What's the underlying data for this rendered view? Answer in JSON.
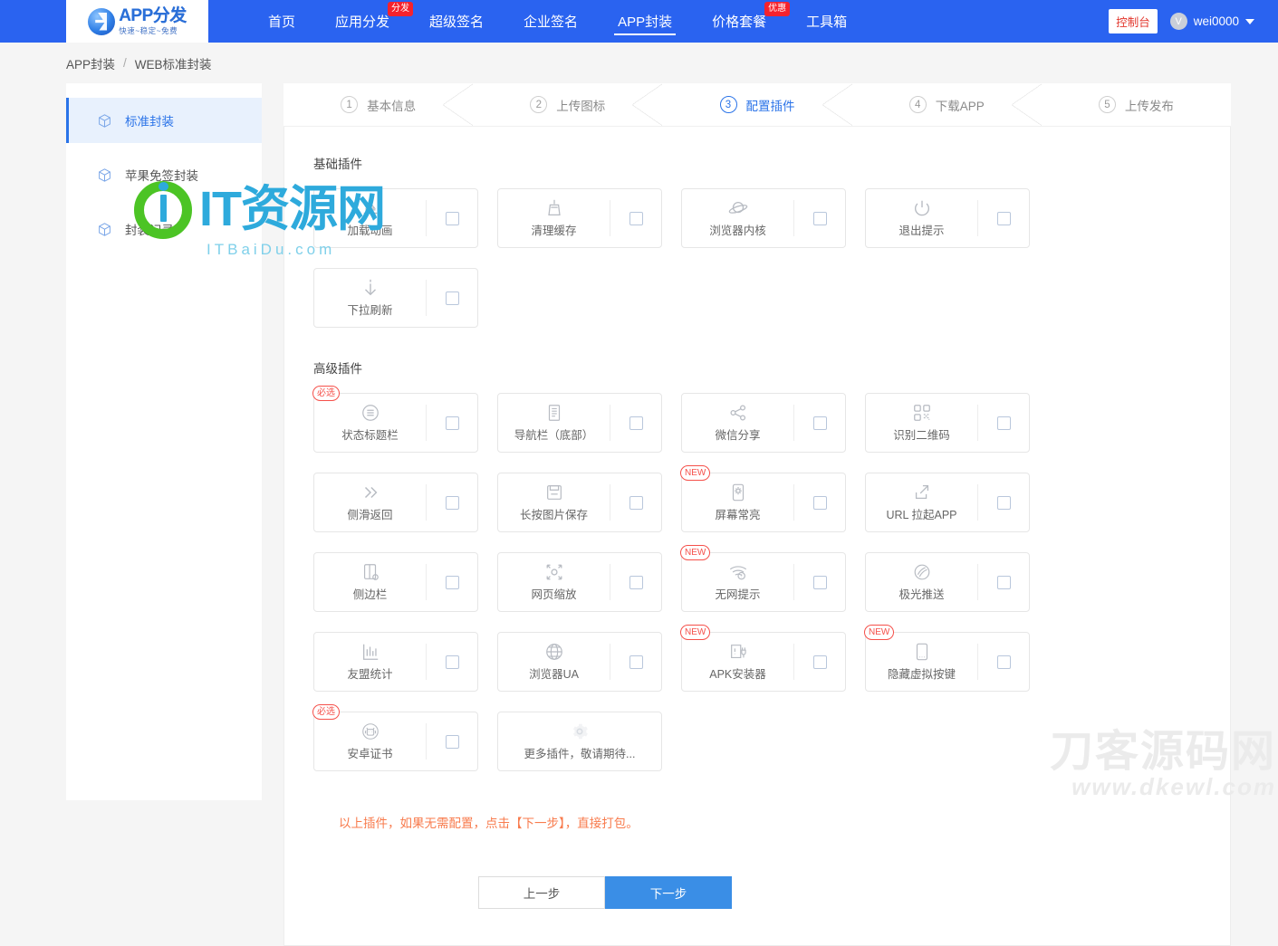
{
  "header": {
    "logo": {
      "title": "APP分发",
      "subtitle": "快速~稳定~免费"
    },
    "nav": [
      {
        "label": "首页",
        "badge": "",
        "active": false
      },
      {
        "label": "应用分发",
        "badge": "分发",
        "active": false
      },
      {
        "label": "超级签名",
        "badge": "",
        "active": false
      },
      {
        "label": "企业签名",
        "badge": "",
        "active": false
      },
      {
        "label": "APP封装",
        "badge": "",
        "active": true
      },
      {
        "label": "价格套餐",
        "badge": "优惠",
        "active": false
      },
      {
        "label": "工具箱",
        "badge": "",
        "active": false
      }
    ],
    "console_label": "控制台",
    "user_initial": "V",
    "user_name": "wei0000"
  },
  "breadcrumb": {
    "root": "APP封装",
    "separator": "/",
    "current": "WEB标准封装"
  },
  "sidebar": {
    "items": [
      {
        "label": "标准封装",
        "icon": "cube-icon",
        "active": true
      },
      {
        "label": "苹果免签封装",
        "icon": "cube-icon",
        "active": false
      },
      {
        "label": "封装记录",
        "icon": "cube-icon",
        "active": false
      }
    ]
  },
  "steps": [
    {
      "num": "1",
      "label": "基本信息",
      "active": false
    },
    {
      "num": "2",
      "label": "上传图标",
      "active": false
    },
    {
      "num": "3",
      "label": "配置插件",
      "active": true
    },
    {
      "num": "4",
      "label": "下载APP",
      "active": false
    },
    {
      "num": "5",
      "label": "上传发布",
      "active": false
    }
  ],
  "sections": {
    "basic_title": "基础插件",
    "advanced_title": "高级插件"
  },
  "basic_plugins": [
    {
      "label": "加载动画",
      "icon": "loading-animation-icon",
      "badge": "",
      "checkbox": true
    },
    {
      "label": "清理缓存",
      "icon": "broom-icon",
      "badge": "",
      "checkbox": true
    },
    {
      "label": "浏览器内核",
      "icon": "planet-icon",
      "badge": "",
      "checkbox": true
    },
    {
      "label": "退出提示",
      "icon": "power-icon",
      "badge": "",
      "checkbox": true
    },
    {
      "label": "下拉刷新",
      "icon": "arrow-down-icon",
      "badge": "",
      "checkbox": true
    }
  ],
  "advanced_plugins": [
    {
      "label": "状态标题栏",
      "icon": "menu-circle-icon",
      "badge": "必选",
      "checkbox": true
    },
    {
      "label": "导航栏（底部）",
      "icon": "document-lines-icon",
      "badge": "",
      "checkbox": true
    },
    {
      "label": "微信分享",
      "icon": "share-nodes-icon",
      "badge": "",
      "checkbox": true
    },
    {
      "label": "识别二维码",
      "icon": "qrcode-icon",
      "badge": "",
      "checkbox": true
    },
    {
      "label": "侧滑返回",
      "icon": "chevron-double-right-icon",
      "badge": "",
      "checkbox": true
    },
    {
      "label": "长按图片保存",
      "icon": "save-floppy-icon",
      "badge": "",
      "checkbox": true
    },
    {
      "label": "屏幕常亮",
      "icon": "phone-brightness-icon",
      "badge": "NEW",
      "checkbox": true
    },
    {
      "label": "URL 拉起APP",
      "icon": "external-launch-icon",
      "badge": "",
      "checkbox": true
    },
    {
      "label": "侧边栏",
      "icon": "sidebar-icon",
      "badge": "",
      "checkbox": true
    },
    {
      "label": "网页缩放",
      "icon": "expand-arrows-icon",
      "badge": "",
      "checkbox": true
    },
    {
      "label": "无网提示",
      "icon": "wifi-warning-icon",
      "badge": "NEW",
      "checkbox": true
    },
    {
      "label": "极光推送",
      "icon": "aurora-push-icon",
      "badge": "",
      "checkbox": true
    },
    {
      "label": "友盟统计",
      "icon": "bar-chart-icon",
      "badge": "",
      "checkbox": true
    },
    {
      "label": "浏览器UA",
      "icon": "globe-icon",
      "badge": "",
      "checkbox": true
    },
    {
      "label": "APK安装器",
      "icon": "apk-installer-icon",
      "badge": "NEW",
      "checkbox": true
    },
    {
      "label": "隐藏虚拟按键",
      "icon": "phone-keys-icon",
      "badge": "NEW",
      "checkbox": true
    },
    {
      "label": "安卓证书",
      "icon": "android-icon",
      "badge": "必选",
      "checkbox": true
    },
    {
      "label": "更多插件，敬请期待...",
      "icon": "gear-icon",
      "badge": "",
      "checkbox": false
    }
  ],
  "footer": {
    "tip": "以上插件，如果无需配置，点击【下一步】，直接打包。",
    "prev_label": "上一步",
    "next_label": "下一步"
  },
  "watermarks": {
    "primary_main": "IT资源网",
    "primary_sub": "ITBaiDu.com",
    "secondary_main": "刀客源码网",
    "secondary_sub": "www.dkewl.com"
  },
  "colors": {
    "brand_blue": "#2a63f0",
    "accent_blue": "#2a73e8",
    "badge_red": "#f5222d",
    "tip_orange": "#f87b4d",
    "next_button": "#3a8ee6"
  }
}
